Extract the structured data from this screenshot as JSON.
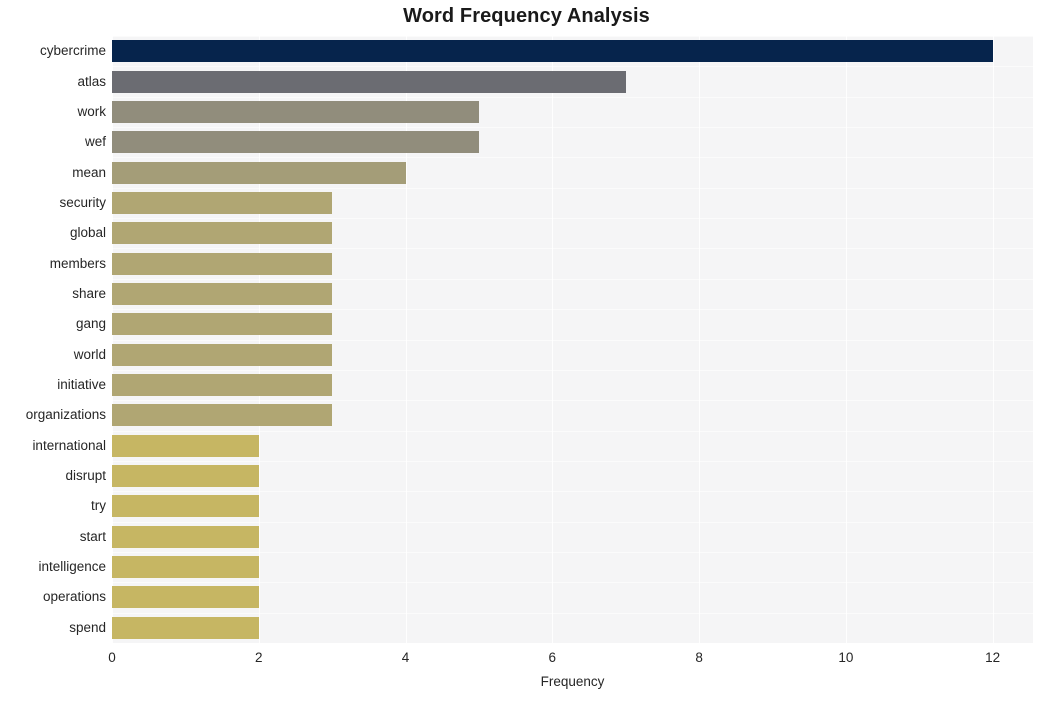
{
  "chart_data": {
    "type": "bar",
    "orientation": "horizontal",
    "title": "Word Frequency Analysis",
    "xlabel": "Frequency",
    "ylabel": "",
    "xlim": [
      0,
      12.55
    ],
    "xticks": [
      0,
      2,
      4,
      6,
      8,
      10,
      12
    ],
    "xtick_labels": [
      "0",
      "2",
      "4",
      "6",
      "8",
      "10",
      "12"
    ],
    "grid": true,
    "grid_axis": "both",
    "legend": null,
    "categories": [
      "cybercrime",
      "atlas",
      "work",
      "wef",
      "mean",
      "security",
      "global",
      "members",
      "share",
      "gang",
      "world",
      "initiative",
      "organizations",
      "international",
      "disrupt",
      "try",
      "start",
      "intelligence",
      "operations",
      "spend"
    ],
    "values": [
      12,
      7,
      5,
      5,
      4,
      3,
      3,
      3,
      3,
      3,
      3,
      3,
      3,
      2,
      2,
      2,
      2,
      2,
      2,
      2
    ],
    "bar_colors": [
      "#06244c",
      "#6b6c72",
      "#918d7c",
      "#918d7c",
      "#a49d78",
      "#b0a673",
      "#b0a673",
      "#b0a673",
      "#b0a673",
      "#b0a673",
      "#b0a673",
      "#b0a673",
      "#b0a673",
      "#c6b663",
      "#c6b663",
      "#c6b663",
      "#c6b663",
      "#c6b663",
      "#c6b663",
      "#c6b663"
    ],
    "plot_background": "#f5f5f6",
    "figure_background": "#ffffff",
    "gridline_color": "#ffffff"
  }
}
